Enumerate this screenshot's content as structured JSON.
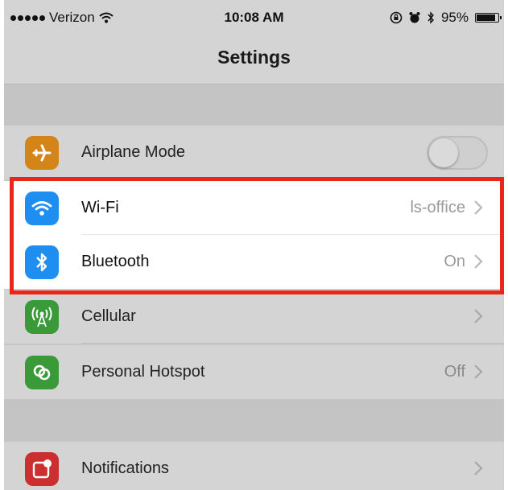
{
  "status_bar": {
    "carrier": "Verizon",
    "time": "10:08 AM",
    "battery_percent_label": "95%",
    "battery_level": 0.95,
    "icons": [
      "signal-dots-icon",
      "wifi-icon",
      "lock-rotation-icon",
      "alarm-icon",
      "bluetooth-icon",
      "battery-icon"
    ]
  },
  "nav": {
    "title": "Settings"
  },
  "rows": {
    "airplane": {
      "label": "Airplane Mode",
      "icon": "airplane-icon",
      "icon_color": "#d48519",
      "toggle_on": false
    },
    "wifi": {
      "label": "Wi-Fi",
      "value": "ls-office",
      "icon": "wifi-icon",
      "icon_color": "#1f8ef1"
    },
    "bluetooth": {
      "label": "Bluetooth",
      "value": "On",
      "icon": "bluetooth-icon",
      "icon_color": "#1f8ef1"
    },
    "cellular": {
      "label": "Cellular",
      "value": "",
      "icon": "cellular-antenna-icon",
      "icon_color": "#3a9a3a"
    },
    "hotspot": {
      "label": "Personal Hotspot",
      "value": "Off",
      "icon": "hotspot-link-icon",
      "icon_color": "#3a9a3a"
    },
    "notifications": {
      "label": "Notifications",
      "value": "",
      "icon": "notifications-icon",
      "icon_color": "#cc2f2f"
    }
  },
  "highlight": {
    "color": "#e8261b",
    "rows": [
      "wifi",
      "bluetooth"
    ]
  }
}
